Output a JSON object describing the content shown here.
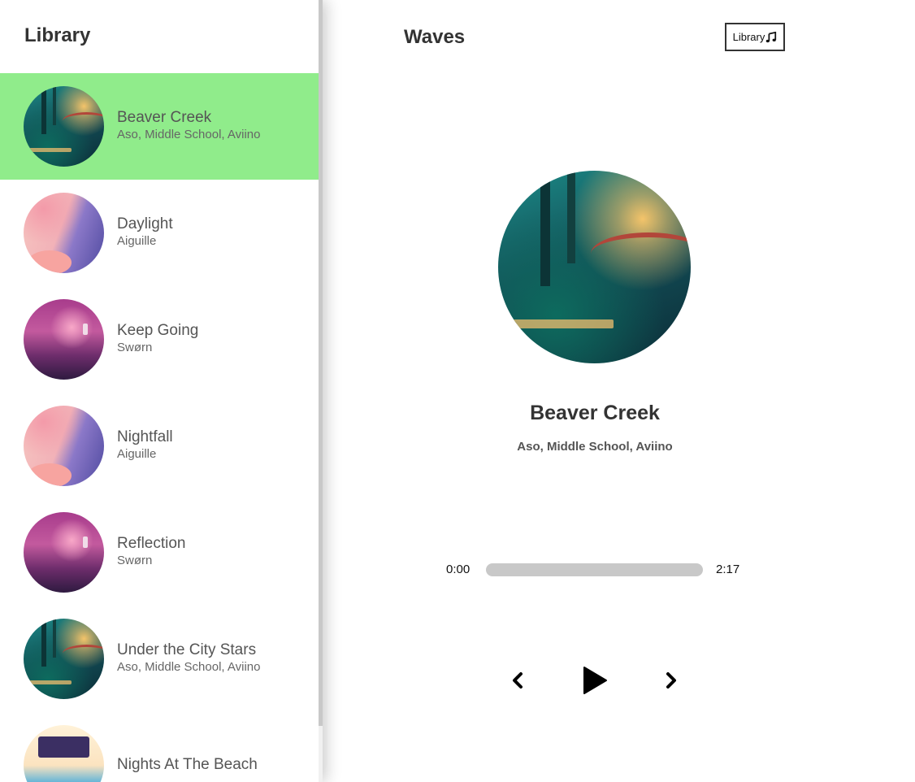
{
  "library": {
    "title": "Library",
    "songs": [
      {
        "name": "Beaver Creek",
        "artist": "Aso, Middle School, Aviino",
        "cover": "forest-art",
        "selected": true
      },
      {
        "name": "Daylight",
        "artist": "Aiguille",
        "cover": "pink-art",
        "selected": false
      },
      {
        "name": "Keep Going",
        "artist": "Swørn",
        "cover": "magenta-art",
        "selected": false
      },
      {
        "name": "Nightfall",
        "artist": "Aiguille",
        "cover": "pink-art",
        "selected": false
      },
      {
        "name": "Reflection",
        "artist": "Swørn",
        "cover": "magenta-art",
        "selected": false
      },
      {
        "name": "Under the City Stars",
        "artist": "Aso, Middle School, Aviino",
        "cover": "forest-art",
        "selected": false
      },
      {
        "name": "Nights At The Beach",
        "artist": "",
        "cover": "beach-art",
        "selected": false
      }
    ]
  },
  "nav": {
    "title": "Waves",
    "library_button_label": "Library",
    "library_button_icon": "music-note-icon"
  },
  "player": {
    "title": "Beaver Creek",
    "artist": "Aso, Middle School, Aviino",
    "cover": "forest-art",
    "current_time": "0:00",
    "duration": "2:17",
    "progress": 0,
    "controls": {
      "prev_icon": "chevron-left-icon",
      "play_icon": "play-icon",
      "next_icon": "chevron-right-icon"
    }
  },
  "colors": {
    "selected_song_bg": "#90ec8b",
    "track": "#c8c8c8",
    "text_dark": "#333333"
  }
}
